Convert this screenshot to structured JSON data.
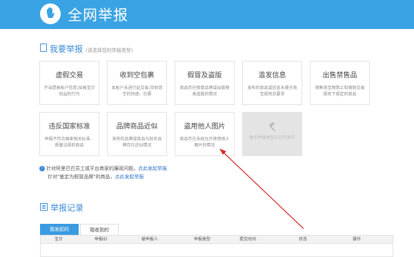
{
  "header": {
    "title": "全网举报"
  },
  "report": {
    "title": "我要举报",
    "hint": "(请选择您的举报类型)",
    "cards": [
      {
        "title": "虚假交易",
        "desc": "不当提高账户信用,抬高宝贝权益的行为"
      },
      {
        "title": "收到空包裹",
        "desc": "本账户未进行此交易,但收到空的快递、包裹"
      },
      {
        "title": "假冒及盗版",
        "desc": "商品存在假冒品牌或出版物类盗版的情况"
      },
      {
        "title": "滥发信息",
        "desc": "发布的商品或信息未遵守淘宝规则及要求"
      },
      {
        "title": "出售禁售品",
        "desc": "销售淘宝网禁止和限制交易规则下规定的商品"
      },
      {
        "title": "违反国家标准",
        "desc": "举报不符合国家相关标准、质量法规的商品"
      },
      {
        "title": "品牌商品近似",
        "desc": "发布的品牌或商品与知名品牌存在近似情况"
      },
      {
        "title": "盗用他人图片",
        "desc": "商品存在未经允许使用他人图片的情况"
      },
      {
        "title": "",
        "desc": "更多举报类型正在开发中"
      }
    ]
  },
  "notice": {
    "line1_text": "针对阿里巴巴员工或平台商家的廉政问题，",
    "line1_link": "点此发起举报",
    "line2_text": "针对\"鉴定为假冒品牌\"的商品，",
    "line2_link": "点此发起举报"
  },
  "records": {
    "title": "举报记录",
    "tabs": [
      "我发起的",
      "我收到的"
    ],
    "columns": [
      "宝贝",
      "举报ID",
      "被举报人",
      "举报类型",
      "提交时间",
      "状态",
      "操作"
    ]
  },
  "colors": {
    "header_bg": "#3aa3e3",
    "accent": "#3a8ad8",
    "arrow": "#d32f2f"
  },
  "icons": {
    "logo": "hand-shield-icon",
    "report": "document-icon",
    "records": "list-icon",
    "disabled_card": "hammer-icon",
    "notice": "info-icon"
  }
}
